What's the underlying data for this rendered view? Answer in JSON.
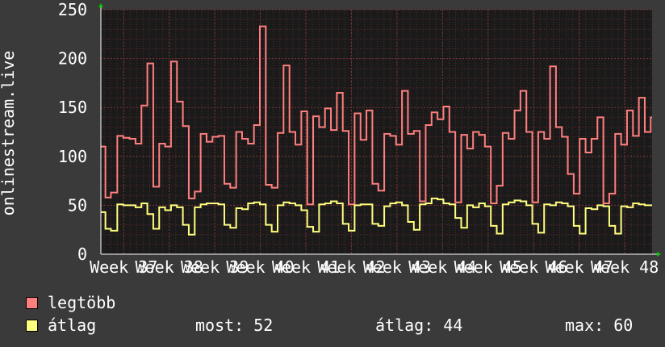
{
  "chart_data": {
    "type": "line",
    "ylabel": "onlinestream.live",
    "ylim": [
      0,
      250
    ],
    "yticks": [
      0,
      50,
      100,
      150,
      200,
      250
    ],
    "categories": [
      "Week 37",
      "Week 38",
      "Week 39",
      "Week 40",
      "Week 41",
      "Week 42",
      "Week 43",
      "Week 44",
      "Week 45",
      "Week 46",
      "Week 47",
      "Week 48"
    ],
    "xlim": [
      36.5,
      48.6
    ],
    "grid": true,
    "series": [
      {
        "name": "legtöbb",
        "color": "#ff7f7f",
        "x": [
          36.5,
          36.6,
          36.72,
          36.86,
          36.99,
          37.13,
          37.26,
          37.39,
          37.52,
          37.65,
          37.78,
          37.91,
          38.04,
          38.17,
          38.3,
          38.43,
          38.56,
          38.69,
          38.82,
          38.95,
          39.08,
          39.21,
          39.34,
          39.47,
          39.6,
          39.73,
          39.86,
          39.99,
          40.12,
          40.25,
          40.38,
          40.51,
          40.64,
          40.77,
          40.9,
          41.03,
          41.16,
          41.29,
          41.42,
          41.55,
          41.68,
          41.81,
          41.94,
          42.07,
          42.2,
          42.33,
          42.46,
          42.59,
          42.72,
          42.85,
          42.98,
          43.11,
          43.24,
          43.37,
          43.5,
          43.63,
          43.76,
          43.89,
          44.02,
          44.15,
          44.28,
          44.41,
          44.54,
          44.67,
          44.8,
          44.93,
          45.06,
          45.19,
          45.32,
          45.45,
          45.58,
          45.71,
          45.84,
          45.97,
          46.1,
          46.23,
          46.36,
          46.49,
          46.62,
          46.75,
          46.88,
          47.01,
          47.14,
          47.27,
          47.4,
          47.53,
          47.66,
          47.79,
          47.92,
          48.05,
          48.18,
          48.31,
          48.44,
          48.57
        ],
        "values": [
          110,
          58,
          63,
          121,
          119,
          118,
          113,
          152,
          195,
          69,
          113,
          110,
          197,
          156,
          131,
          57,
          64,
          123,
          115,
          120,
          121,
          72,
          68,
          125,
          118,
          113,
          132,
          233,
          71,
          68,
          124,
          193,
          125,
          112,
          146,
          51,
          141,
          130,
          149,
          127,
          165,
          126,
          51,
          144,
          117,
          147,
          72,
          65,
          123,
          121,
          112,
          167,
          123,
          126,
          54,
          132,
          145,
          138,
          151,
          125,
          53,
          122,
          108,
          125,
          122,
          110,
          52,
          70,
          124,
          118,
          147,
          167,
          125,
          53,
          125,
          118,
          192,
          130,
          120,
          82,
          62,
          118,
          104,
          118,
          140,
          52,
          62,
          123,
          112,
          147,
          121,
          160,
          125,
          140
        ]
      },
      {
        "name": "átlag",
        "color": "#ffff7f",
        "x": [
          36.5,
          36.6,
          36.72,
          36.86,
          36.99,
          37.13,
          37.26,
          37.39,
          37.52,
          37.65,
          37.78,
          37.91,
          38.04,
          38.17,
          38.3,
          38.43,
          38.56,
          38.69,
          38.82,
          38.95,
          39.08,
          39.21,
          39.34,
          39.47,
          39.6,
          39.73,
          39.86,
          39.99,
          40.12,
          40.25,
          40.38,
          40.51,
          40.64,
          40.77,
          40.9,
          41.03,
          41.16,
          41.29,
          41.42,
          41.55,
          41.68,
          41.81,
          41.94,
          42.07,
          42.2,
          42.33,
          42.46,
          42.59,
          42.72,
          42.85,
          42.98,
          43.11,
          43.24,
          43.37,
          43.5,
          43.63,
          43.76,
          43.89,
          44.02,
          44.15,
          44.28,
          44.41,
          44.54,
          44.67,
          44.8,
          44.93,
          45.06,
          45.19,
          45.32,
          45.45,
          45.58,
          45.71,
          45.84,
          45.97,
          46.1,
          46.23,
          46.36,
          46.49,
          46.62,
          46.75,
          46.88,
          47.01,
          47.14,
          47.27,
          47.4,
          47.53,
          47.66,
          47.79,
          47.92,
          48.05,
          48.18,
          48.31,
          48.44,
          48.57
        ],
        "values": [
          43,
          26,
          24,
          51,
          50,
          50,
          48,
          52,
          41,
          26,
          48,
          45,
          50,
          48,
          30,
          20,
          48,
          51,
          52,
          52,
          51,
          30,
          27,
          47,
          46,
          52,
          53,
          51,
          30,
          23,
          50,
          53,
          52,
          50,
          45,
          28,
          23,
          51,
          52,
          54,
          52,
          31,
          24,
          50,
          51,
          51,
          31,
          29,
          49,
          52,
          53,
          50,
          33,
          25,
          51,
          52,
          57,
          56,
          52,
          51,
          37,
          27,
          50,
          48,
          52,
          49,
          29,
          21,
          51,
          53,
          55,
          54,
          50,
          31,
          22,
          51,
          50,
          53,
          52,
          49,
          29,
          21,
          47,
          46,
          50,
          49,
          29,
          21,
          49,
          48,
          52,
          51,
          50,
          50
        ]
      }
    ]
  },
  "legend": {
    "items": [
      {
        "label": "legtöbb",
        "color": "#ff7f7f"
      },
      {
        "label": "átlag",
        "color": "#ffff7f"
      }
    ]
  },
  "stats": {
    "now_label": "most:",
    "now_value": "52",
    "avg_label": "átlag:",
    "avg_value": "44",
    "max_label": "max:",
    "max_value": "60"
  }
}
